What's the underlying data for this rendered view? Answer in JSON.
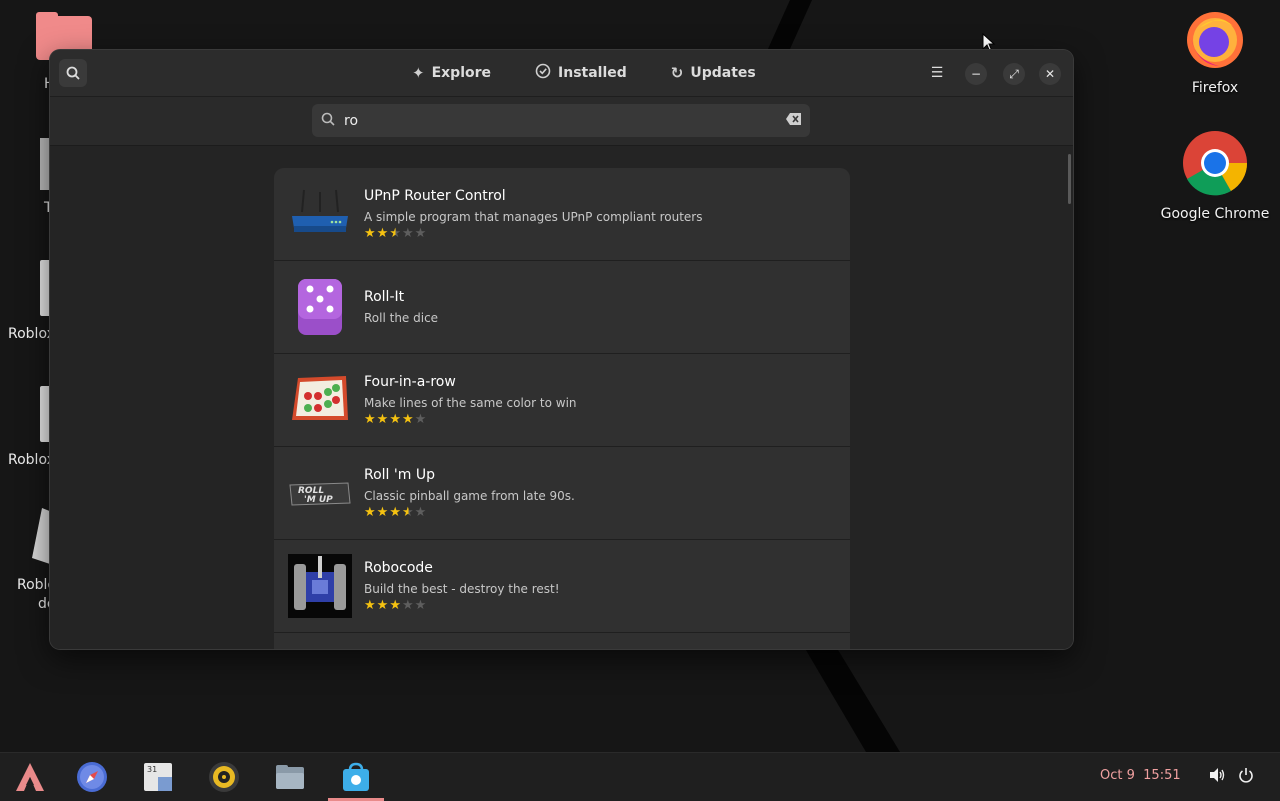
{
  "desktop": {
    "icons_right": [
      {
        "label": "Firefox",
        "icon": "firefox-icon"
      },
      {
        "label": "Google Chrome",
        "icon": "chrome-icon"
      }
    ],
    "icons_left": [
      {
        "label": "H",
        "icon": "home-folder-icon"
      },
      {
        "label": "T",
        "icon": "trash-icon"
      },
      {
        "label": "Roblox",
        "icon": "file-icon"
      },
      {
        "label": "Roblox",
        "icon": "file-icon"
      },
      {
        "label": "Roblo",
        "icon": "file-icon"
      },
      {
        "label": "de",
        "icon": "file-icon"
      }
    ]
  },
  "window": {
    "tabs": [
      {
        "label": "Explore",
        "icon": "explore-icon"
      },
      {
        "label": "Installed",
        "icon": "installed-check-icon"
      },
      {
        "label": "Updates",
        "icon": "updates-refresh-icon"
      }
    ],
    "search": {
      "value": "ro",
      "placeholder": ""
    },
    "results": [
      {
        "name": "UPnP Router Control",
        "description": "A simple program that manages UPnP compliant routers",
        "rating": 2.5,
        "icon": "router-icon"
      },
      {
        "name": "Roll-It",
        "description": "Roll the dice",
        "rating": null,
        "icon": "dice-icon"
      },
      {
        "name": "Four-in-a-row",
        "description": "Make lines of the same color to win",
        "rating": 4,
        "icon": "four-in-a-row-icon"
      },
      {
        "name": "Roll 'm Up",
        "description": "Classic pinball game from late 90s.",
        "rating": 3.5,
        "icon": "pinball-icon"
      },
      {
        "name": "Robocode",
        "description": "Build the best - destroy the rest!",
        "rating": 3,
        "icon": "robocode-icon"
      }
    ]
  },
  "taskbar": {
    "apps": [
      "launcher-icon",
      "web-browser-icon",
      "calendar-icon",
      "music-player-icon",
      "files-icon",
      "software-store-icon"
    ],
    "calendar_day": "31",
    "date": "Oct 9",
    "time": "15:51"
  },
  "colors": {
    "accent": "#e98a8a",
    "star": "#f5c211"
  }
}
